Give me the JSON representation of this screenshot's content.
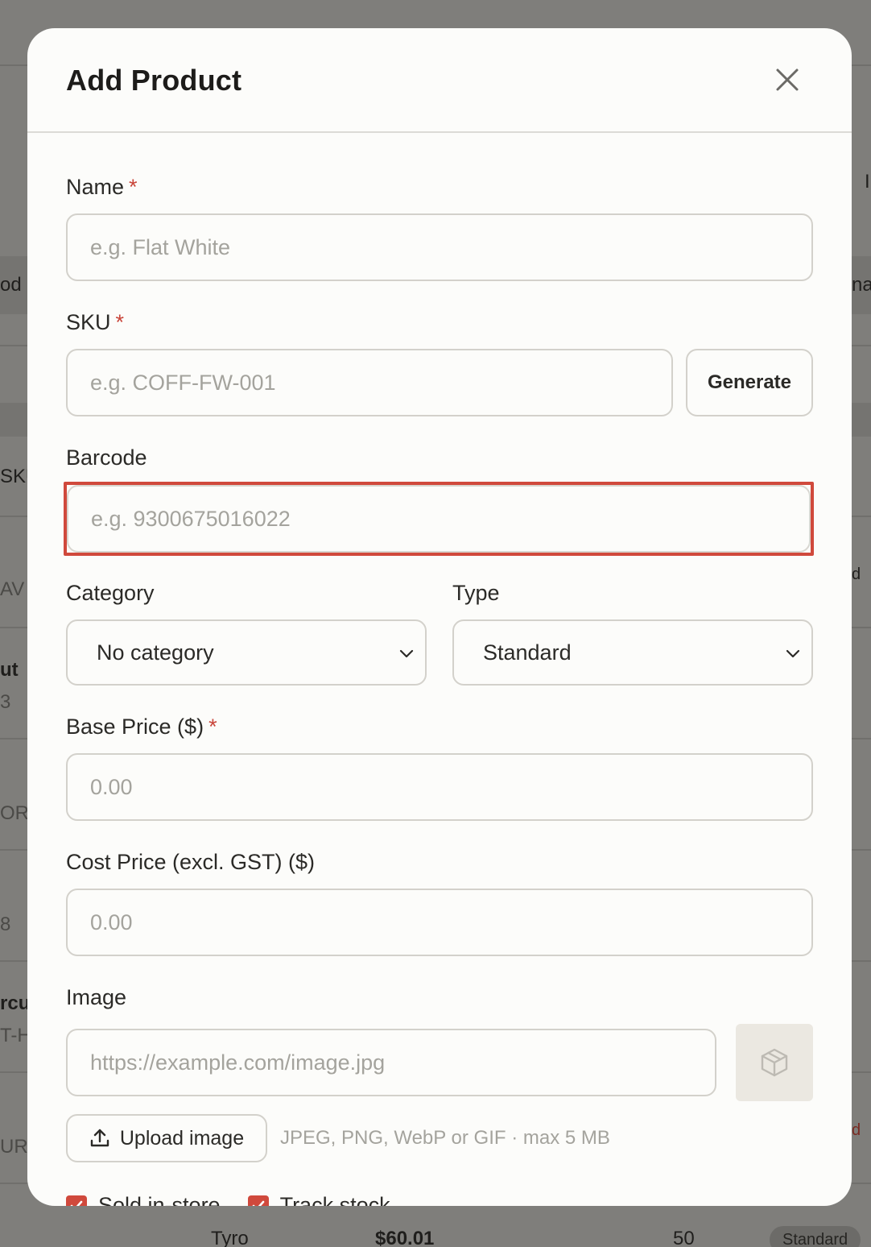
{
  "modal": {
    "title": "Add Product",
    "fields": {
      "name": {
        "label": "Name",
        "required": "*",
        "placeholder": "e.g. Flat White",
        "value": ""
      },
      "sku": {
        "label": "SKU",
        "required": "*",
        "placeholder": "e.g. COFF-FW-001",
        "value": "",
        "generate_label": "Generate"
      },
      "barcode": {
        "label": "Barcode",
        "placeholder": "e.g. 9300675016022",
        "value": ""
      },
      "category": {
        "label": "Category",
        "selected": "No category"
      },
      "type": {
        "label": "Type",
        "selected": "Standard"
      },
      "base_price": {
        "label": "Base Price ($)",
        "required": "*",
        "placeholder": "0.00",
        "value": ""
      },
      "cost_price": {
        "label": "Cost Price (excl. GST) ($)",
        "placeholder": "0.00",
        "value": ""
      },
      "image": {
        "label": "Image",
        "placeholder": "https://example.com/image.jpg",
        "value": "",
        "upload_label": "Upload image",
        "hint": "JPEG, PNG, WebP or GIF · max 5 MB"
      }
    },
    "checkboxes": [
      {
        "label": "Sold in-store",
        "checked": true
      },
      {
        "label": "Track stock",
        "checked": true
      }
    ]
  },
  "background": {
    "fragments": [
      "I",
      "od",
      "na",
      "SKU",
      "AV",
      "d",
      "ut",
      "3",
      "OR",
      "8",
      "rcu",
      "T-H",
      "URG",
      "d"
    ],
    "footer_row": {
      "provider": "Tyro",
      "price": "$60.01",
      "qty": "50",
      "type": "Standard"
    }
  },
  "colors": {
    "accent": "#d0493c",
    "required": "#c9453a",
    "modal_bg": "#fcfcfa",
    "overlay": "#7f7e7b"
  }
}
